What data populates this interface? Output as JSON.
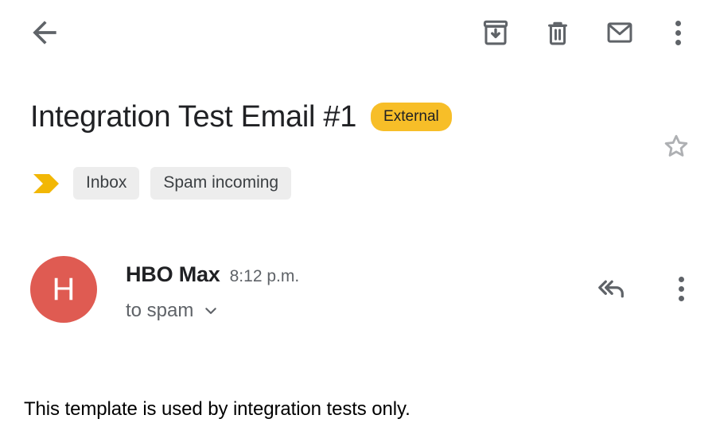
{
  "topbar": {
    "back": {
      "label": "Back",
      "icon": "arrow-left-icon"
    },
    "actions": [
      {
        "name": "archive",
        "label": "Archive",
        "icon": "archive-icon"
      },
      {
        "name": "delete",
        "label": "Delete",
        "icon": "trash-icon"
      },
      {
        "name": "mark-unread",
        "label": "Mark as unread",
        "icon": "envelope-icon"
      },
      {
        "name": "more",
        "label": "More options",
        "icon": "overflow-menu-icon"
      }
    ]
  },
  "subject": {
    "title": "Integration Test Email #1",
    "badge": "External",
    "badge_color": "#F7BE28",
    "star": {
      "label": "Star",
      "icon": "star-outline-icon",
      "starred": false
    }
  },
  "labels": {
    "important_marker": {
      "icon": "important-chevron-icon",
      "color": "#F2B705"
    },
    "chips": [
      {
        "label": "Inbox"
      },
      {
        "label": "Spam incoming"
      }
    ],
    "chip_bg": "#EDEDED"
  },
  "message": {
    "avatar": {
      "initial": "H",
      "color": "#DF5B52"
    },
    "sender": "HBO Max",
    "time": "8:12 p.m.",
    "recipient": "to spam",
    "expand_icon": "chevron-down-icon",
    "actions": [
      {
        "name": "reply-all",
        "label": "Reply all",
        "icon": "reply-all-icon"
      },
      {
        "name": "more",
        "label": "More options",
        "icon": "overflow-menu-icon"
      }
    ]
  },
  "body": {
    "text": "This template is used by integration tests only."
  }
}
